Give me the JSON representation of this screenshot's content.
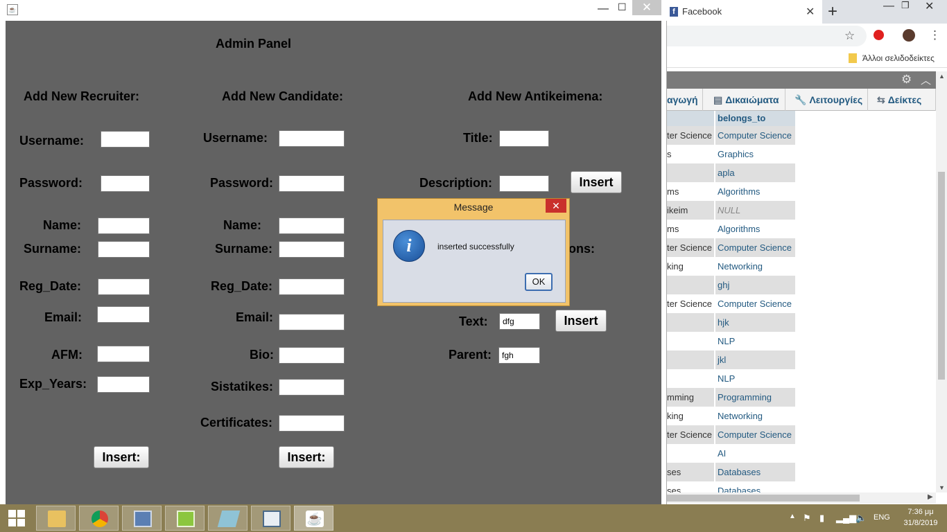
{
  "browser": {
    "tab_title": "Facebook",
    "tab_close": "✕",
    "new_tab": "+",
    "bookmarks_label": "Άλλοι σελιδοδείκτες",
    "pma_tabs": [
      {
        "label": "αγωγή"
      },
      {
        "label": "Δικαιώματα",
        "icon": "permissions-icon"
      },
      {
        "label": "Λειτουργίες",
        "icon": "wrench-icon"
      },
      {
        "label": "Δείκτες",
        "icon": "triggers-icon"
      }
    ],
    "table": {
      "header_b": "belongs_to",
      "rows": [
        {
          "a": "ter Science",
          "b": "Computer Science"
        },
        {
          "a": "s",
          "b": "Graphics"
        },
        {
          "a": "",
          "b": "apla"
        },
        {
          "a": "ms",
          "b": "Algorithms"
        },
        {
          "a": "ikeim",
          "b": "NULL"
        },
        {
          "a": "ms",
          "b": "Algorithms"
        },
        {
          "a": "ter Science",
          "b": "Computer Science"
        },
        {
          "a": "king",
          "b": "Networking"
        },
        {
          "a": "",
          "b": "ghj"
        },
        {
          "a": "ter Science",
          "b": "Computer Science"
        },
        {
          "a": "",
          "b": "hjk"
        },
        {
          "a": "",
          "b": "NLP"
        },
        {
          "a": "",
          "b": "jkl"
        },
        {
          "a": "",
          "b": "NLP"
        },
        {
          "a": "mming",
          "b": "Programming"
        },
        {
          "a": "king",
          "b": "Networking"
        },
        {
          "a": "ter Science",
          "b": "Computer Science"
        },
        {
          "a": "",
          "b": "AI"
        },
        {
          "a": "ses",
          "b": "Databases"
        },
        {
          "a": "ses",
          "b": "Databases"
        }
      ]
    }
  },
  "window": {
    "title": "",
    "panel_title": "Admin Panel",
    "recruiter": {
      "heading": "Add New Recruiter:",
      "username": "Username:",
      "password": "Password:",
      "name": "Name:",
      "surname": "Surname:",
      "reg_date": "Reg_Date:",
      "email": "Email:",
      "afm": "AFM:",
      "exp_years": "Exp_Years:",
      "insert": "Insert:"
    },
    "candidate": {
      "heading": "Add New Candidate:",
      "username": "Username:",
      "password": "Password:",
      "name": "Name:",
      "surname": "Surname:",
      "reg_date": "Reg_Date:",
      "email": "Email:",
      "bio": "Bio:",
      "sistatikes": "Sistatikes:",
      "certificates": "Certificates:",
      "insert": "Insert:"
    },
    "antikeimena": {
      "heading": "Add New Antikeimena:",
      "title": "Title:",
      "description": "Description:",
      "insert": "Insert",
      "partial_label": "ons:",
      "text": "Text:",
      "text_value": "dfg",
      "parent": "Parent:",
      "parent_value": "fgh",
      "insert2": "Insert"
    }
  },
  "dialog": {
    "title": "Message",
    "close": "✕",
    "message": "inserted successfully",
    "ok": "OK"
  },
  "taskbar": {
    "apps": [
      "file-explorer",
      "chrome",
      "virtualbox",
      "notepad-plus-plus",
      "eraser-app",
      "window-app",
      "java-app"
    ],
    "tray": {
      "language": "ENG",
      "time": "7:36 μμ",
      "date": "31/8/2019"
    }
  }
}
